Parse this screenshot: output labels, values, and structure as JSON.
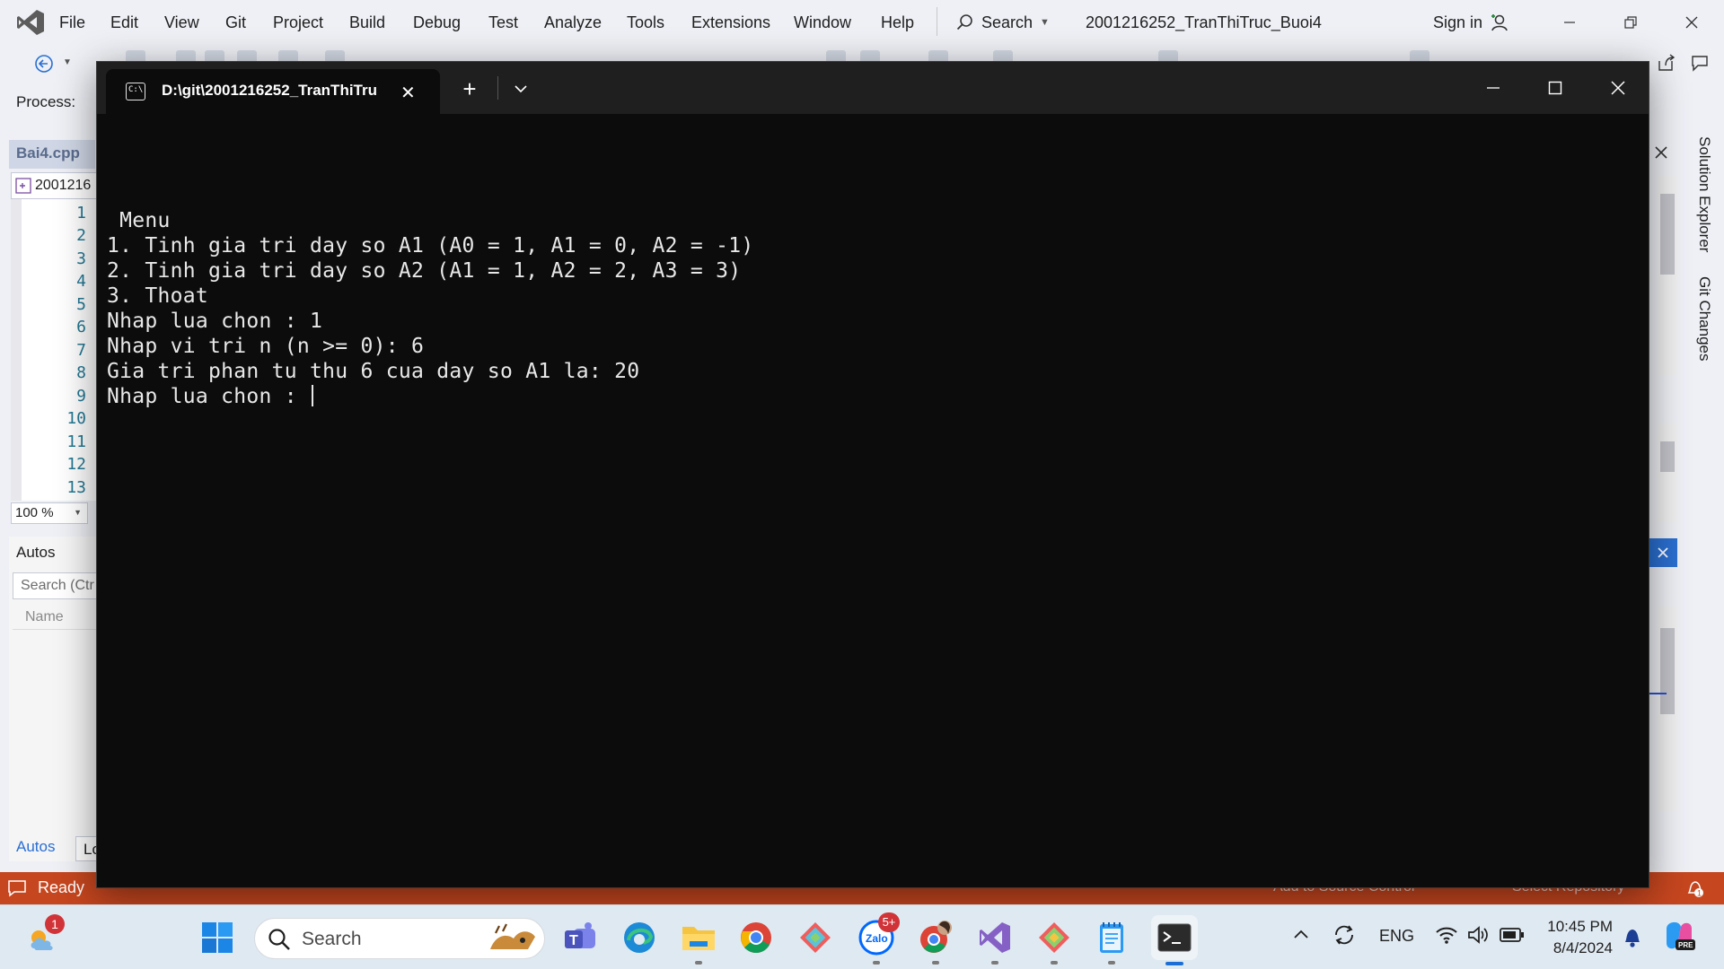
{
  "vs": {
    "menu": [
      "File",
      "Edit",
      "View",
      "Git",
      "Project",
      "Build",
      "Debug",
      "Test",
      "Analyze",
      "Tools",
      "Extensions",
      "Window",
      "Help"
    ],
    "search_label": "Search",
    "solution_title": "2001216252_TranThiTruc_Buoi4",
    "signin_label": "Sign in",
    "process_label": "Process:",
    "doc_tab": "Bai4.cpp",
    "scope_text": "2001216",
    "line_numbers": [
      "1",
      "2",
      "3",
      "4",
      "5",
      "6",
      "7",
      "8",
      "9",
      "10",
      "11",
      "12",
      "13"
    ],
    "zoom": "100 %",
    "autos_title": "Autos",
    "autos_search_placeholder": "Search (Ctr",
    "autos_column": "Name",
    "autos_tab": "Autos",
    "locals_tab": "Lo",
    "right_tabs": [
      "Solution Explorer",
      "Git Changes"
    ],
    "status_ready": "Ready",
    "status_source_control": "Add to Source Control",
    "status_repo": "Select Repository",
    "status_color": "#c6461f"
  },
  "terminal": {
    "tab_title": "D:\\git\\2001216252_TranThiTru",
    "lines": [
      " Menu",
      "1. Tinh gia tri day so A1 (A0 = 1, A1 = 0, A2 = -1)",
      "2. Tinh gia tri day so A2 (A1 = 1, A2 = 2, A3 = 3)",
      "3. Thoat",
      "Nhap lua chon : 1",
      "Nhap vi tri n (n >= 0): 6",
      "Gia tri phan tu thu 6 cua day so A1 la: 20",
      "Nhap lua chon : "
    ],
    "background": "#0c0c0c"
  },
  "taskbar": {
    "weather_badge": "1",
    "search_label": "Search",
    "zalo_badge": "5+",
    "tray_lang": "ENG",
    "time": "10:45 PM",
    "date": "8/4/2024",
    "notification_count": "1",
    "apps": [
      "weather-icon",
      "windows-start-icon",
      "search",
      "teams-icon",
      "edge-icon",
      "file-explorer-icon",
      "chrome-icon",
      "git-kraken-icon",
      "zalo-icon",
      "chrome-profile-icon",
      "visual-studio-icon",
      "git-icon",
      "notepad-icon",
      "terminal-icon"
    ]
  }
}
